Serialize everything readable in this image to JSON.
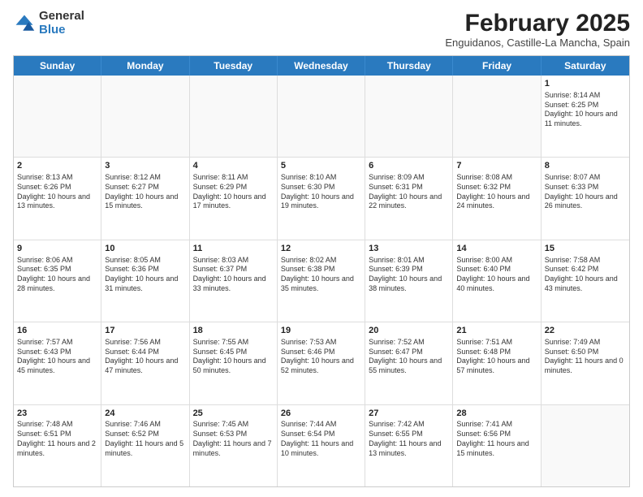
{
  "logo": {
    "general": "General",
    "blue": "Blue"
  },
  "title": {
    "month": "February 2025",
    "location": "Enguidanos, Castille-La Mancha, Spain"
  },
  "header_days": [
    "Sunday",
    "Monday",
    "Tuesday",
    "Wednesday",
    "Thursday",
    "Friday",
    "Saturday"
  ],
  "weeks": [
    [
      {
        "day": "",
        "text": ""
      },
      {
        "day": "",
        "text": ""
      },
      {
        "day": "",
        "text": ""
      },
      {
        "day": "",
        "text": ""
      },
      {
        "day": "",
        "text": ""
      },
      {
        "day": "",
        "text": ""
      },
      {
        "day": "1",
        "text": "Sunrise: 8:14 AM\nSunset: 6:25 PM\nDaylight: 10 hours and 11 minutes."
      }
    ],
    [
      {
        "day": "2",
        "text": "Sunrise: 8:13 AM\nSunset: 6:26 PM\nDaylight: 10 hours and 13 minutes."
      },
      {
        "day": "3",
        "text": "Sunrise: 8:12 AM\nSunset: 6:27 PM\nDaylight: 10 hours and 15 minutes."
      },
      {
        "day": "4",
        "text": "Sunrise: 8:11 AM\nSunset: 6:29 PM\nDaylight: 10 hours and 17 minutes."
      },
      {
        "day": "5",
        "text": "Sunrise: 8:10 AM\nSunset: 6:30 PM\nDaylight: 10 hours and 19 minutes."
      },
      {
        "day": "6",
        "text": "Sunrise: 8:09 AM\nSunset: 6:31 PM\nDaylight: 10 hours and 22 minutes."
      },
      {
        "day": "7",
        "text": "Sunrise: 8:08 AM\nSunset: 6:32 PM\nDaylight: 10 hours and 24 minutes."
      },
      {
        "day": "8",
        "text": "Sunrise: 8:07 AM\nSunset: 6:33 PM\nDaylight: 10 hours and 26 minutes."
      }
    ],
    [
      {
        "day": "9",
        "text": "Sunrise: 8:06 AM\nSunset: 6:35 PM\nDaylight: 10 hours and 28 minutes."
      },
      {
        "day": "10",
        "text": "Sunrise: 8:05 AM\nSunset: 6:36 PM\nDaylight: 10 hours and 31 minutes."
      },
      {
        "day": "11",
        "text": "Sunrise: 8:03 AM\nSunset: 6:37 PM\nDaylight: 10 hours and 33 minutes."
      },
      {
        "day": "12",
        "text": "Sunrise: 8:02 AM\nSunset: 6:38 PM\nDaylight: 10 hours and 35 minutes."
      },
      {
        "day": "13",
        "text": "Sunrise: 8:01 AM\nSunset: 6:39 PM\nDaylight: 10 hours and 38 minutes."
      },
      {
        "day": "14",
        "text": "Sunrise: 8:00 AM\nSunset: 6:40 PM\nDaylight: 10 hours and 40 minutes."
      },
      {
        "day": "15",
        "text": "Sunrise: 7:58 AM\nSunset: 6:42 PM\nDaylight: 10 hours and 43 minutes."
      }
    ],
    [
      {
        "day": "16",
        "text": "Sunrise: 7:57 AM\nSunset: 6:43 PM\nDaylight: 10 hours and 45 minutes."
      },
      {
        "day": "17",
        "text": "Sunrise: 7:56 AM\nSunset: 6:44 PM\nDaylight: 10 hours and 47 minutes."
      },
      {
        "day": "18",
        "text": "Sunrise: 7:55 AM\nSunset: 6:45 PM\nDaylight: 10 hours and 50 minutes."
      },
      {
        "day": "19",
        "text": "Sunrise: 7:53 AM\nSunset: 6:46 PM\nDaylight: 10 hours and 52 minutes."
      },
      {
        "day": "20",
        "text": "Sunrise: 7:52 AM\nSunset: 6:47 PM\nDaylight: 10 hours and 55 minutes."
      },
      {
        "day": "21",
        "text": "Sunrise: 7:51 AM\nSunset: 6:48 PM\nDaylight: 10 hours and 57 minutes."
      },
      {
        "day": "22",
        "text": "Sunrise: 7:49 AM\nSunset: 6:50 PM\nDaylight: 11 hours and 0 minutes."
      }
    ],
    [
      {
        "day": "23",
        "text": "Sunrise: 7:48 AM\nSunset: 6:51 PM\nDaylight: 11 hours and 2 minutes."
      },
      {
        "day": "24",
        "text": "Sunrise: 7:46 AM\nSunset: 6:52 PM\nDaylight: 11 hours and 5 minutes."
      },
      {
        "day": "25",
        "text": "Sunrise: 7:45 AM\nSunset: 6:53 PM\nDaylight: 11 hours and 7 minutes."
      },
      {
        "day": "26",
        "text": "Sunrise: 7:44 AM\nSunset: 6:54 PM\nDaylight: 11 hours and 10 minutes."
      },
      {
        "day": "27",
        "text": "Sunrise: 7:42 AM\nSunset: 6:55 PM\nDaylight: 11 hours and 13 minutes."
      },
      {
        "day": "28",
        "text": "Sunrise: 7:41 AM\nSunset: 6:56 PM\nDaylight: 11 hours and 15 minutes."
      },
      {
        "day": "",
        "text": ""
      }
    ]
  ]
}
